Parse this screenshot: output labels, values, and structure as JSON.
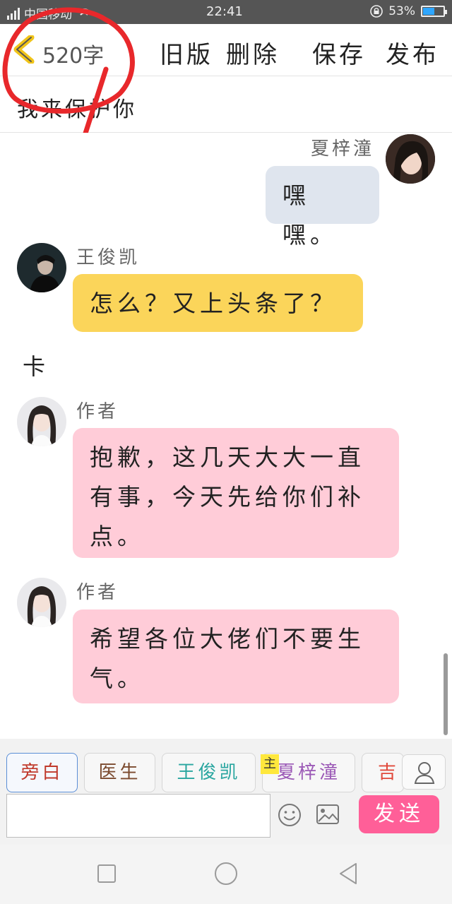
{
  "status_bar": {
    "carrier": "中国移动",
    "time": "22:41",
    "battery_percent": "53%",
    "battery_level": 0.53
  },
  "header": {
    "back_icon": "chevron-left-icon",
    "word_count": "520字",
    "buttons": [
      "旧版",
      "删除",
      "保存",
      "发布"
    ]
  },
  "story": {
    "title": "我来保护你"
  },
  "messages": [
    {
      "side": "right",
      "name": "夏梓潼",
      "text": "嘿嘿。",
      "bubble_color": "#dfe5ee"
    },
    {
      "side": "left",
      "name": "王俊凯",
      "text": "怎么？又上头条了？",
      "bubble_color": "#fbd55a"
    },
    {
      "type": "narration",
      "text": "卡"
    },
    {
      "side": "left",
      "name": "作者",
      "text_lines": [
        "抱歉，这几天大大一直",
        "有事，今天先给你们补",
        "点。"
      ],
      "bubble_color": "#ffccd8"
    },
    {
      "side": "left",
      "name": "作者",
      "text_lines": [
        "希望各位大佬们不要生",
        "气。"
      ],
      "bubble_color": "#ffccd8"
    }
  ],
  "role_tabs": [
    {
      "label": "旁白",
      "color": "#c0392b"
    },
    {
      "label": "医生",
      "color": "#7b4a2e"
    },
    {
      "label": "王俊凯",
      "color": "#2aa6a0"
    },
    {
      "label": "夏梓潼",
      "color": "#9b59b6"
    },
    {
      "label": "吉",
      "color": "#e0483a"
    }
  ],
  "main_badge": "主",
  "composer": {
    "placeholder": "",
    "send_label": "发送",
    "emoji_icon": "smiley-icon",
    "image_icon": "image-icon",
    "user_icon": "user-icon"
  },
  "nav": {
    "recent_icon": "square-icon",
    "home_icon": "circle-icon",
    "back_icon": "triangle-back-icon"
  },
  "colors": {
    "send_button": "#ff5f98",
    "annotation_circle": "#e8282b",
    "active_tab_border": "#5b8ed6"
  }
}
